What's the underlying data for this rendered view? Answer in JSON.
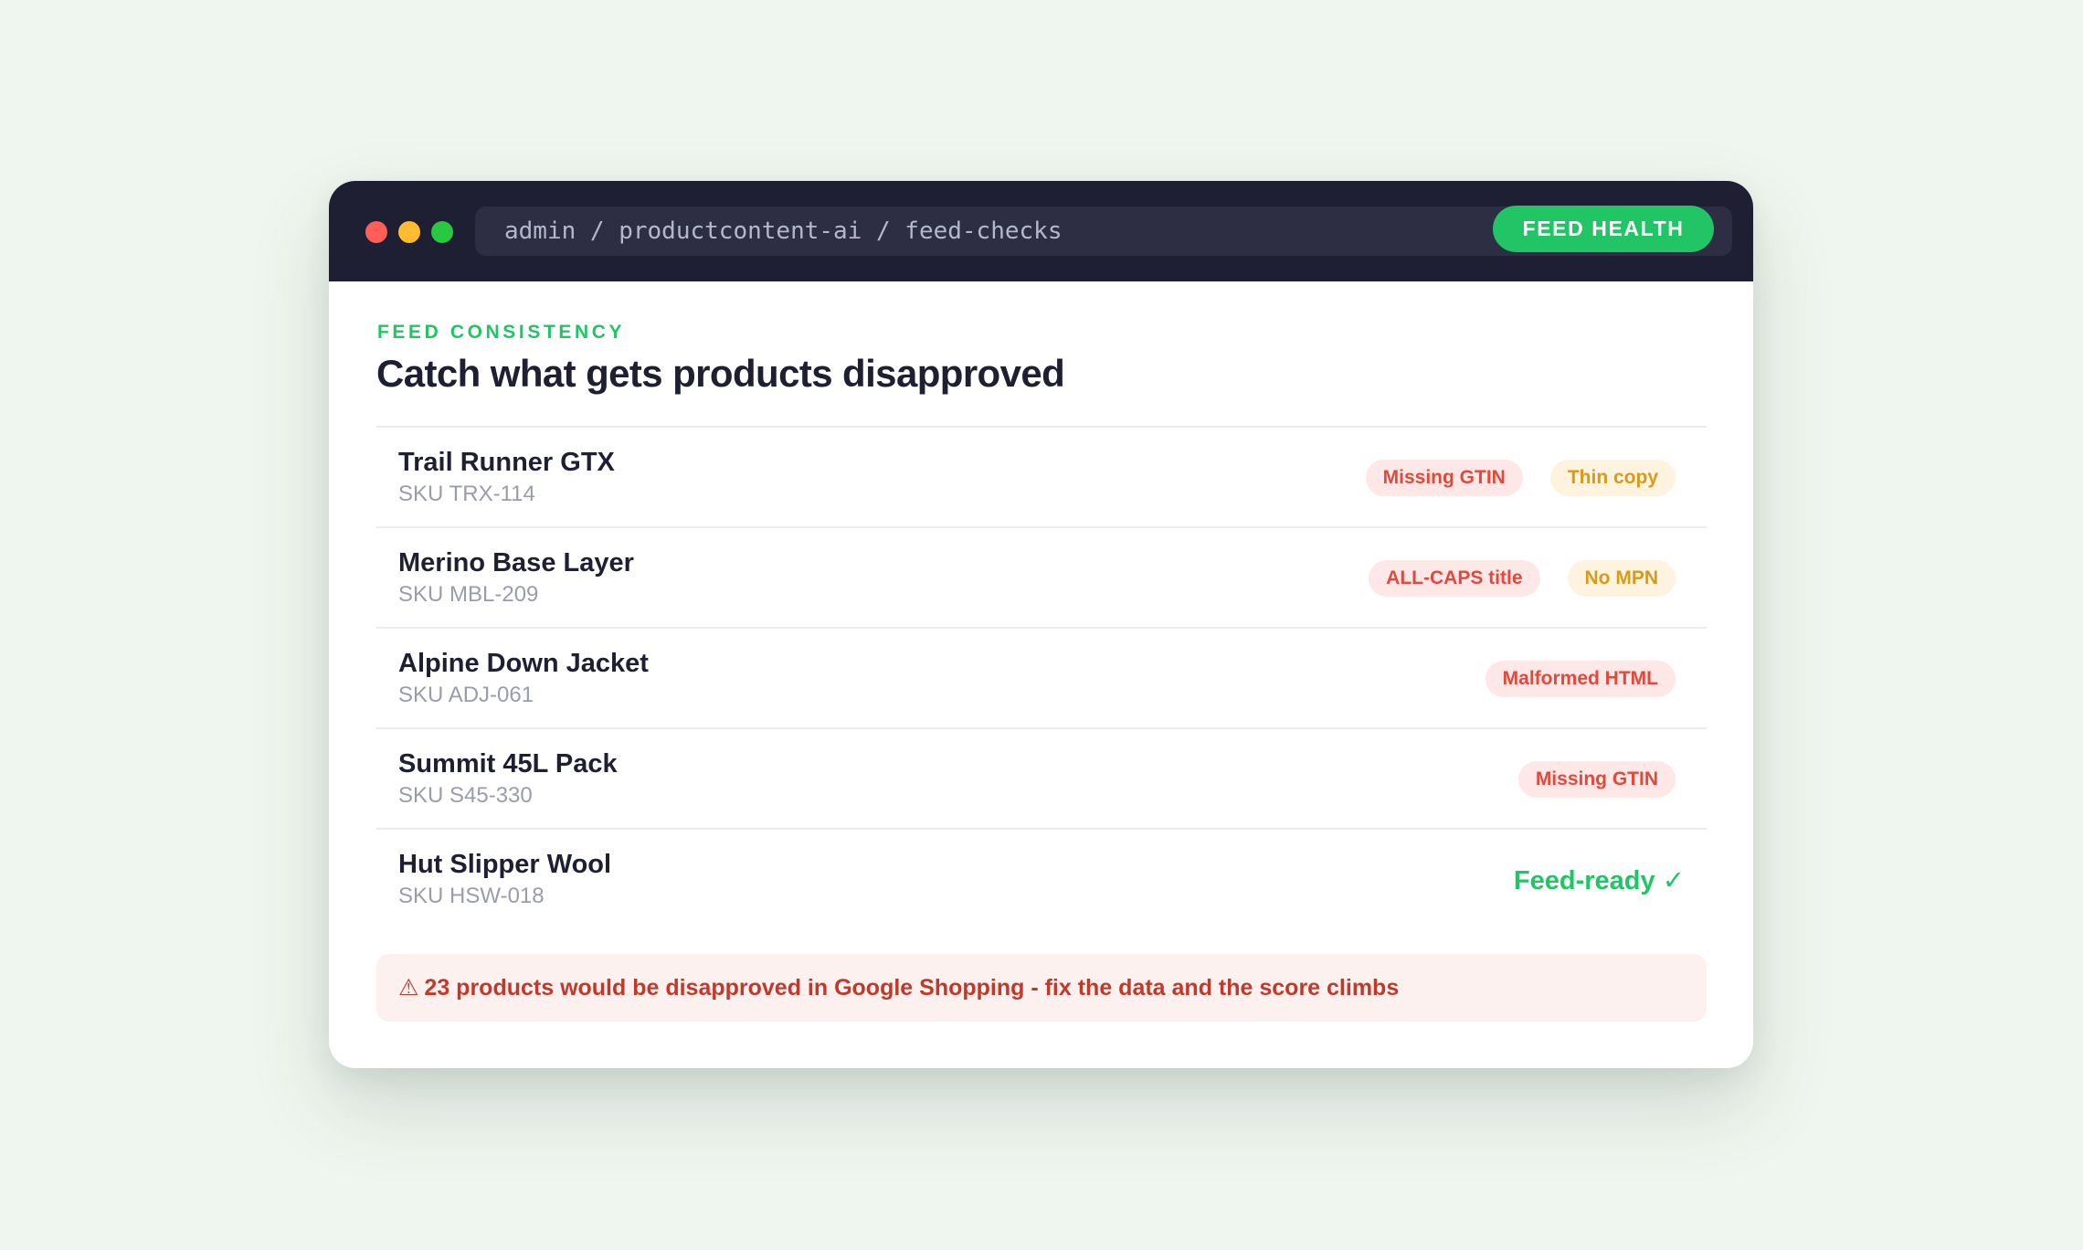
{
  "titlebar": {
    "url": "admin / productcontent-ai / feed-checks",
    "badge_label": "FEED HEALTH"
  },
  "header": {
    "eyebrow": "FEED CONSISTENCY",
    "title": "Catch what gets products disapproved"
  },
  "products": [
    {
      "name": "Trail Runner GTX",
      "sku": "SKU TRX-114",
      "issues": [
        {
          "label": "Missing GTIN",
          "severity": "error"
        },
        {
          "label": "Thin copy",
          "severity": "warning"
        }
      ]
    },
    {
      "name": "Merino Base Layer",
      "sku": "SKU MBL-209",
      "issues": [
        {
          "label": "ALL-CAPS title",
          "severity": "error"
        },
        {
          "label": "No MPN",
          "severity": "warning"
        }
      ]
    },
    {
      "name": "Alpine Down Jacket",
      "sku": "SKU ADJ-061",
      "issues": [
        {
          "label": "Malformed HTML",
          "severity": "error"
        }
      ]
    },
    {
      "name": "Summit 45L Pack",
      "sku": "SKU S45-330",
      "issues": [
        {
          "label": "Missing GTIN",
          "severity": "error"
        }
      ]
    },
    {
      "name": "Hut Slipper Wool",
      "sku": "SKU HSW-018",
      "status": "Feed-ready ✓"
    }
  ],
  "alert": {
    "icon": "⚠",
    "icon_name": "warning-triangle-icon",
    "text": "23 products would be disapproved in Google Shopping - fix the data and the score climbs"
  },
  "colors": {
    "accent_green": "#21c565",
    "error_red": "#e04a3c",
    "warning_amber": "#d99a1a",
    "titlebar_dark": "#1e1f33"
  }
}
